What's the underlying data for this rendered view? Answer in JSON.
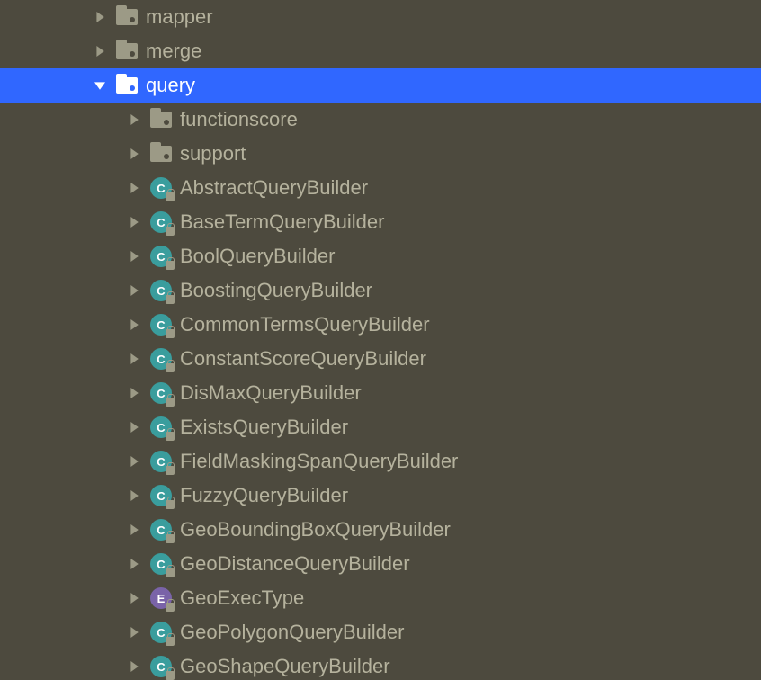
{
  "icons": {
    "class_letter": "C",
    "enum_letter": "E"
  },
  "tree": {
    "rows": [
      {
        "depth": 0,
        "arrow": "right",
        "iconType": "folder",
        "label": "mapper",
        "selected": false
      },
      {
        "depth": 0,
        "arrow": "right",
        "iconType": "folder",
        "label": "merge",
        "selected": false
      },
      {
        "depth": 0,
        "arrow": "down",
        "iconType": "folder",
        "label": "query",
        "selected": true
      },
      {
        "depth": 1,
        "arrow": "right",
        "iconType": "folder",
        "label": "functionscore",
        "selected": false
      },
      {
        "depth": 1,
        "arrow": "right",
        "iconType": "folder",
        "label": "support",
        "selected": false
      },
      {
        "depth": 1,
        "arrow": "right",
        "iconType": "class-lock",
        "label": "AbstractQueryBuilder",
        "selected": false
      },
      {
        "depth": 1,
        "arrow": "right",
        "iconType": "class-lock",
        "label": "BaseTermQueryBuilder",
        "selected": false
      },
      {
        "depth": 1,
        "arrow": "right",
        "iconType": "class-lock",
        "label": "BoolQueryBuilder",
        "selected": false
      },
      {
        "depth": 1,
        "arrow": "right",
        "iconType": "class-lock",
        "label": "BoostingQueryBuilder",
        "selected": false
      },
      {
        "depth": 1,
        "arrow": "right",
        "iconType": "class-lock",
        "label": "CommonTermsQueryBuilder",
        "selected": false
      },
      {
        "depth": 1,
        "arrow": "right",
        "iconType": "class-lock",
        "label": "ConstantScoreQueryBuilder",
        "selected": false
      },
      {
        "depth": 1,
        "arrow": "right",
        "iconType": "class-lock",
        "label": "DisMaxQueryBuilder",
        "selected": false
      },
      {
        "depth": 1,
        "arrow": "right",
        "iconType": "class-lock",
        "label": "ExistsQueryBuilder",
        "selected": false
      },
      {
        "depth": 1,
        "arrow": "right",
        "iconType": "class-lock",
        "label": "FieldMaskingSpanQueryBuilder",
        "selected": false
      },
      {
        "depth": 1,
        "arrow": "right",
        "iconType": "class-lock",
        "label": "FuzzyQueryBuilder",
        "selected": false
      },
      {
        "depth": 1,
        "arrow": "right",
        "iconType": "class-lock",
        "label": "GeoBoundingBoxQueryBuilder",
        "selected": false
      },
      {
        "depth": 1,
        "arrow": "right",
        "iconType": "class-lock",
        "label": "GeoDistanceQueryBuilder",
        "selected": false
      },
      {
        "depth": 1,
        "arrow": "right",
        "iconType": "enum-lock",
        "label": "GeoExecType",
        "selected": false
      },
      {
        "depth": 1,
        "arrow": "right",
        "iconType": "class-lock",
        "label": "GeoPolygonQueryBuilder",
        "selected": false
      },
      {
        "depth": 1,
        "arrow": "right",
        "iconType": "class-lock",
        "label": "GeoShapeQueryBuilder",
        "selected": false
      }
    ]
  }
}
